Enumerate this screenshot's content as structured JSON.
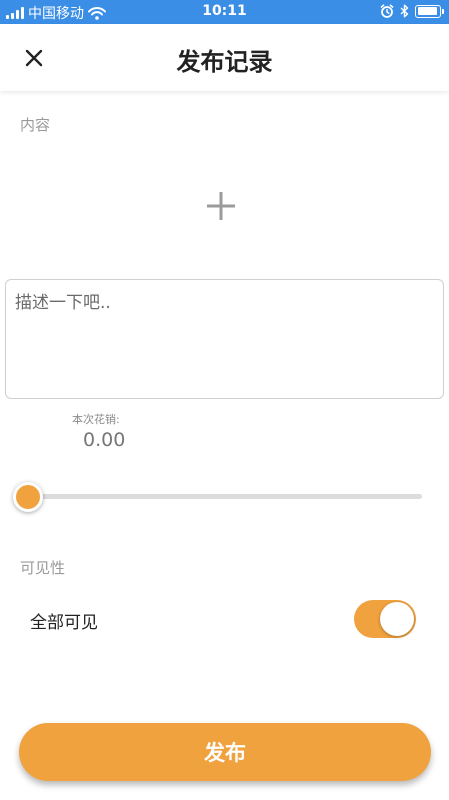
{
  "status_bar": {
    "carrier": "中国移动",
    "time": "10:11",
    "battery_level": 0.95,
    "icons": [
      "signal-icon",
      "wifi-icon",
      "alarm-icon",
      "bluetooth-icon",
      "battery-icon"
    ]
  },
  "header": {
    "title": "发布记录",
    "close_icon": "close-icon"
  },
  "content": {
    "label": "内容",
    "add_icon": "plus-icon"
  },
  "description": {
    "placeholder": "描述一下吧..",
    "value": ""
  },
  "cost": {
    "label": "本次花销:",
    "value": "0.00",
    "slider_fraction": 0
  },
  "visibility": {
    "label": "可见性",
    "option_label": "全部可见",
    "enabled": true
  },
  "actions": {
    "publish_label": "发布"
  },
  "colors": {
    "accent": "#f0a23e",
    "status_bar": "#3a8ee6"
  }
}
